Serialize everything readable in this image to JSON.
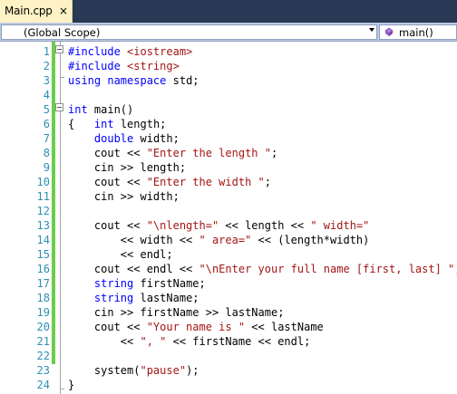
{
  "tab": {
    "filename": "Main.cpp",
    "close_glyph": "×"
  },
  "navigation": {
    "scope": "(Global Scope)",
    "member": "main()",
    "member_icon": "method-icon"
  },
  "colors": {
    "keyword": "#0000ff",
    "string": "#a31515",
    "line_number": "#2b91af",
    "change_bar": "#6ace4d",
    "tab_active": "#fff3c5",
    "tabbar_bg": "#293955"
  },
  "line_numbers": [
    "1",
    "2",
    "3",
    "4",
    "5",
    "6",
    "7",
    "8",
    "9",
    "10",
    "11",
    "12",
    "13",
    "14",
    "15",
    "16",
    "17",
    "18",
    "19",
    "20",
    "21",
    "22",
    "23",
    "24"
  ],
  "code_lines": [
    [
      {
        "t": "#include ",
        "c": "pp"
      },
      {
        "t": "<iostream>",
        "c": "str"
      }
    ],
    [
      {
        "t": "#include ",
        "c": "pp"
      },
      {
        "t": "<string>",
        "c": "str"
      }
    ],
    [
      {
        "t": "using",
        "c": "kw"
      },
      {
        "t": " "
      },
      {
        "t": "namespace",
        "c": "kw"
      },
      {
        "t": " std;"
      }
    ],
    [],
    [
      {
        "t": "int",
        "c": "kw"
      },
      {
        "t": " main()"
      }
    ],
    [
      {
        "t": "{   "
      },
      {
        "t": "int",
        "c": "kw"
      },
      {
        "t": " length;"
      }
    ],
    [
      {
        "t": "    "
      },
      {
        "t": "double",
        "c": "kw"
      },
      {
        "t": " width;"
      }
    ],
    [
      {
        "t": "    cout << "
      },
      {
        "t": "\"Enter the length \"",
        "c": "str"
      },
      {
        "t": ";"
      }
    ],
    [
      {
        "t": "    cin >> length;"
      }
    ],
    [
      {
        "t": "    cout << "
      },
      {
        "t": "\"Enter the width \"",
        "c": "str"
      },
      {
        "t": ";"
      }
    ],
    [
      {
        "t": "    cin >> width;"
      }
    ],
    [],
    [
      {
        "t": "    cout << "
      },
      {
        "t": "\"\\nlength=\"",
        "c": "str"
      },
      {
        "t": " << length << "
      },
      {
        "t": "\" width=\"",
        "c": "str"
      }
    ],
    [
      {
        "t": "        << width << "
      },
      {
        "t": "\" area=\"",
        "c": "str"
      },
      {
        "t": " << (length*width)"
      }
    ],
    [
      {
        "t": "        << endl;"
      }
    ],
    [
      {
        "t": "    cout << endl << "
      },
      {
        "t": "\"\\nEnter your full name [first, last] \"",
        "c": "str"
      },
      {
        "t": ";"
      }
    ],
    [
      {
        "t": "    "
      },
      {
        "t": "string",
        "c": "kw"
      },
      {
        "t": " firstName;"
      }
    ],
    [
      {
        "t": "    "
      },
      {
        "t": "string",
        "c": "kw"
      },
      {
        "t": " lastName;"
      }
    ],
    [
      {
        "t": "    cin >> firstName >> lastName;"
      }
    ],
    [
      {
        "t": "    cout << "
      },
      {
        "t": "\"Your name is \"",
        "c": "str"
      },
      {
        "t": " << lastName"
      }
    ],
    [
      {
        "t": "        << "
      },
      {
        "t": "\", \"",
        "c": "str"
      },
      {
        "t": " << firstName << endl;"
      }
    ],
    [],
    [
      {
        "t": "    system("
      },
      {
        "t": "\"pause\"",
        "c": "str"
      },
      {
        "t": ");"
      }
    ],
    [
      {
        "t": "}"
      }
    ]
  ]
}
